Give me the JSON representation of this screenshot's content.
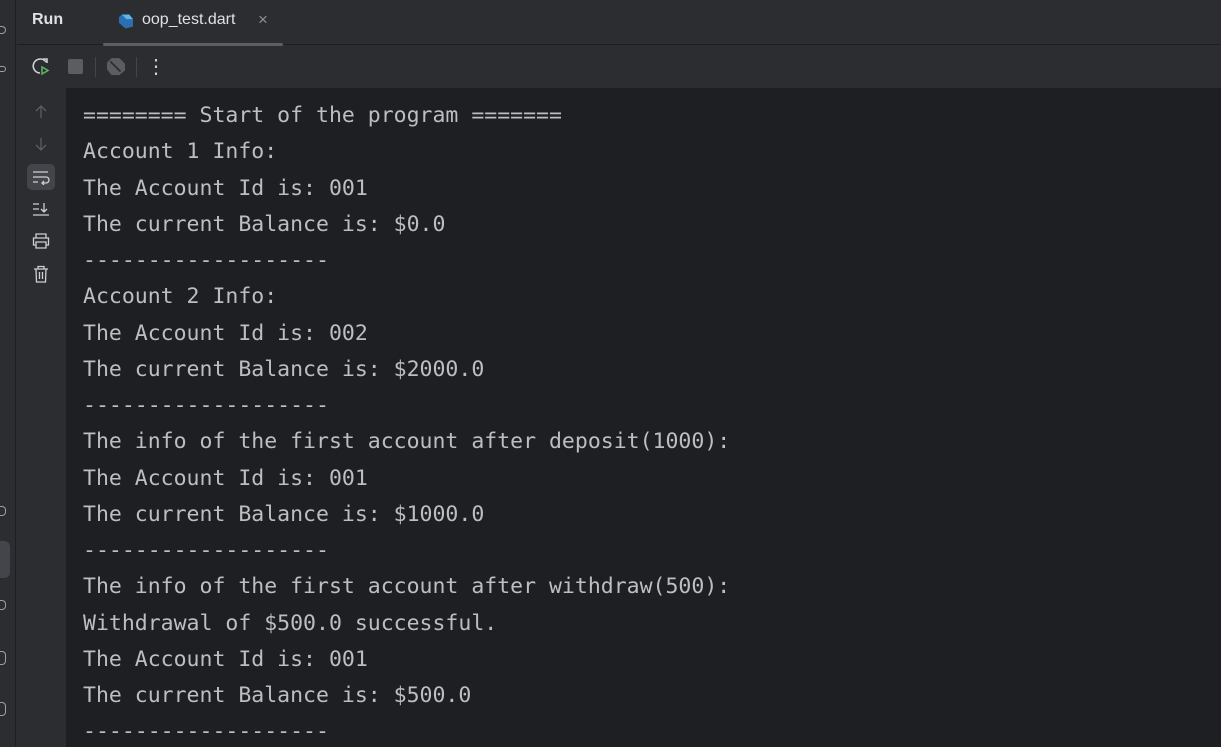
{
  "header": {
    "run_label": "Run",
    "tab": {
      "name": "oop_test.dart",
      "close": "×"
    }
  },
  "toolbar": {
    "rerun": "rerun-icon",
    "stop": "stop-icon",
    "debug": "dart-debug-icon",
    "more": "⋮"
  },
  "sidebar": [
    "scroll-up-icon",
    "scroll-down-icon",
    "soft-wrap-icon",
    "scroll-to-end-icon",
    "print-icon",
    "trash-icon"
  ],
  "console": {
    "lines": [
      "======== Start of the program =======",
      "Account 1 Info:",
      "The Account Id is: 001",
      "The current Balance is: $0.0",
      "-------------------",
      "Account 2 Info:",
      "The Account Id is: 002",
      "The current Balance is: $2000.0",
      "-------------------",
      "The info of the first account after deposit(1000):",
      "The Account Id is: 001",
      "The current Balance is: $1000.0",
      "-------------------",
      "The info of the first account after withdraw(500):",
      "Withdrawal of $500.0 successful.",
      "The Account Id is: 001",
      "The current Balance is: $500.0",
      "-------------------"
    ]
  }
}
